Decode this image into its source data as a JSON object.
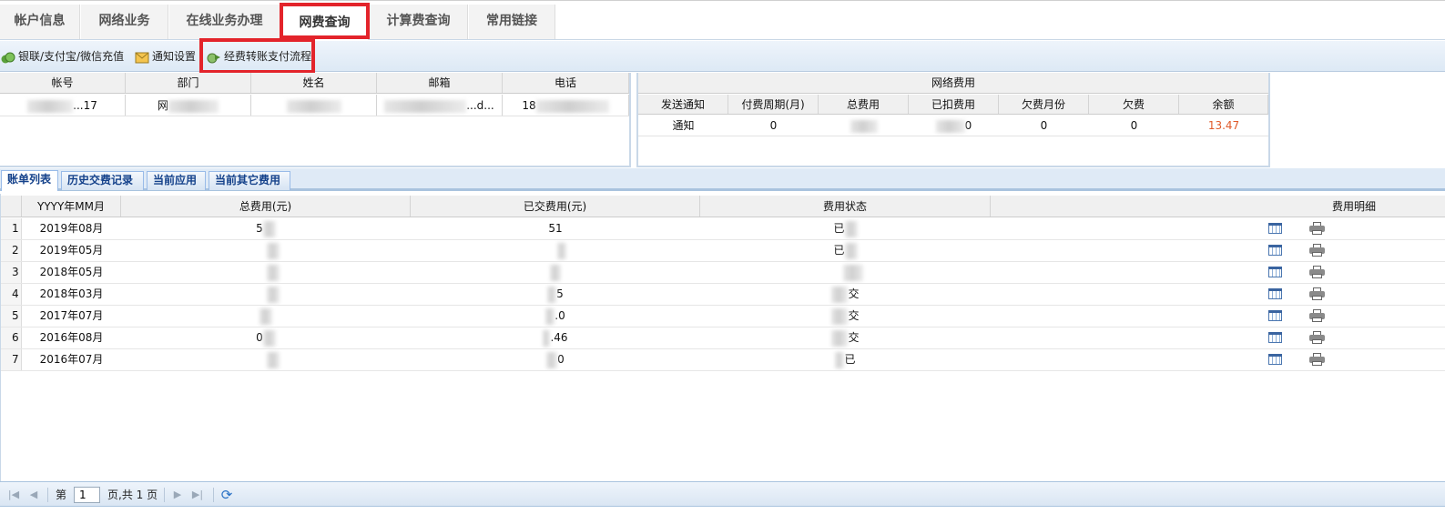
{
  "top_tabs": [
    {
      "label": "帐户信息"
    },
    {
      "label": "网络业务"
    },
    {
      "label": "在线业务办理"
    },
    {
      "label": "网费查询",
      "active": true
    },
    {
      "label": "计算费查询"
    },
    {
      "label": "常用链接"
    }
  ],
  "toolbar": {
    "recharge": "银联/支付宝/微信充值",
    "notify_settings": "通知设置",
    "transfer_flow": "经费转账支付流程"
  },
  "user_table": {
    "headers": [
      "帐号",
      "部门",
      "姓名",
      "邮箱",
      "电话"
    ],
    "row": [
      "...17",
      "网",
      "",
      "...d...",
      "18"
    ]
  },
  "fee_panel": {
    "title": "网络费用",
    "headers": [
      "发送通知",
      "付费周期(月)",
      "总费用",
      "已扣费用",
      "欠费月份",
      "欠费",
      "余额"
    ],
    "row": [
      "通知",
      "0",
      "",
      "0",
      "0",
      "0",
      "13.47"
    ],
    "balance_color": "#e05a2a"
  },
  "sub_tabs": [
    {
      "label": "账单列表",
      "active": true
    },
    {
      "label": "历史交费记录"
    },
    {
      "label": "当前应用"
    },
    {
      "label": "当前其它费用"
    }
  ],
  "bill_table": {
    "headers": [
      "YYYY年MM月",
      "总费用(元)",
      "已交费用(元)",
      "费用状态",
      "费用明细"
    ],
    "rows": [
      {
        "num": "1",
        "month": "2019年08月",
        "total": "5",
        "paid": "51",
        "status": "已"
      },
      {
        "num": "2",
        "month": "2019年05月",
        "total": "",
        "paid": "",
        "status": "已"
      },
      {
        "num": "3",
        "month": "2018年05月",
        "total": "",
        "paid": "",
        "status": ""
      },
      {
        "num": "4",
        "month": "2018年03月",
        "total": "",
        "paid": "5",
        "status": "交"
      },
      {
        "num": "5",
        "month": "2017年07月",
        "total": "",
        "paid": ".0",
        "status": "交"
      },
      {
        "num": "6",
        "month": "2016年08月",
        "total": "0",
        "paid": ".46",
        "status": "交"
      },
      {
        "num": "7",
        "month": "2016年07月",
        "total": "",
        "paid": "0",
        "status": "已"
      }
    ]
  },
  "pager": {
    "page_prefix": "第",
    "page_value": "1",
    "page_suffix": "页,共 1 页"
  }
}
